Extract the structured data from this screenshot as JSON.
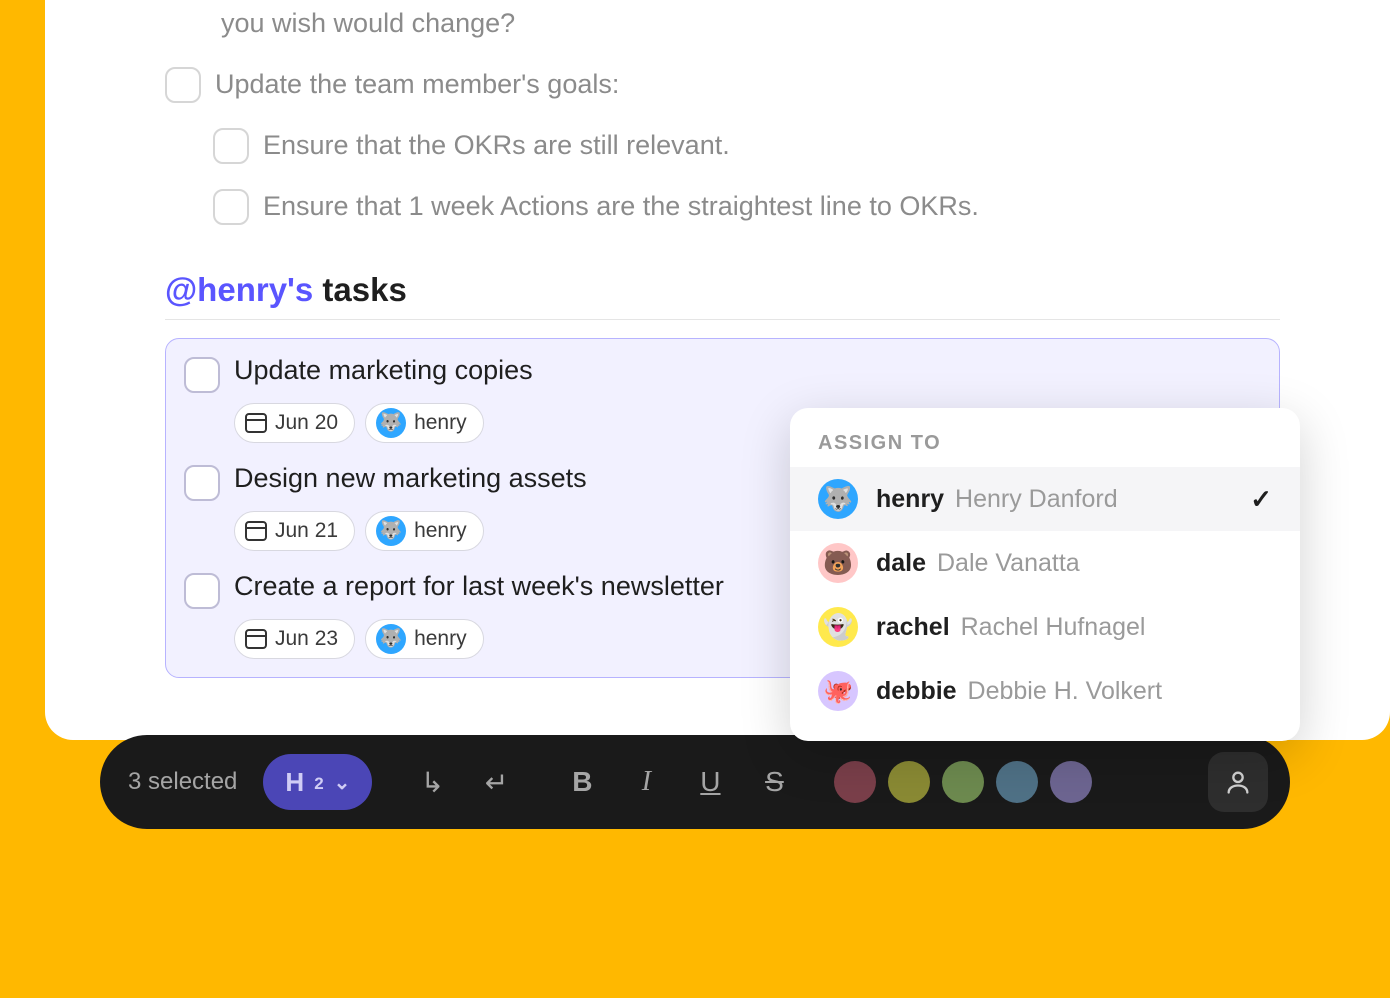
{
  "doc": {
    "lines": [
      {
        "kind": "text",
        "text": "you wish would change?"
      },
      {
        "kind": "check",
        "text": "Update the team member's goals:"
      },
      {
        "kind": "check_indent",
        "text": "Ensure that the OKRs are still relevant."
      },
      {
        "kind": "check_indent",
        "text": "Ensure that 1 week Actions are the straightest line to OKRs."
      }
    ]
  },
  "section": {
    "mention": "@henry's",
    "title_rest": " tasks"
  },
  "tasks": [
    {
      "title": "Update marketing copies",
      "date": "Jun 20",
      "assignee_name": "henry",
      "assignee_av": "av-blue",
      "assignee_emoji": "🐺"
    },
    {
      "title": "Design new marketing assets",
      "date": "Jun 21",
      "assignee_name": "henry",
      "assignee_av": "av-blue",
      "assignee_emoji": "🐺"
    },
    {
      "title": "Create a report for last week's newsletter",
      "date": "Jun 23",
      "assignee_name": "henry",
      "assignee_av": "av-blue",
      "assignee_emoji": "🐺"
    }
  ],
  "popup": {
    "header": "ASSIGN TO",
    "items": [
      {
        "username": "henry",
        "fullname": "Henry Danford",
        "av": "av-blue",
        "emoji": "🐺",
        "selected": true
      },
      {
        "username": "dale",
        "fullname": "Dale Vanatta",
        "av": "av-pink",
        "emoji": "🐻",
        "selected": false
      },
      {
        "username": "rachel",
        "fullname": "Rachel Hufnagel",
        "av": "av-yellow",
        "emoji": "👻",
        "selected": false
      },
      {
        "username": "debbie",
        "fullname": "Debbie H. Volkert",
        "av": "av-lilac",
        "emoji": "🐙",
        "selected": false
      }
    ]
  },
  "toolbar": {
    "selection": "3 selected",
    "heading_label_main": "H",
    "heading_label_sub": "2",
    "buttons": {
      "indent": "↳",
      "outdent": "↵",
      "bold": "B",
      "italic": "I",
      "underline": "U",
      "strike": "S"
    },
    "colors": [
      "#7a3f4a",
      "#8a8a34",
      "#6d8a4f",
      "#4f7186",
      "#6d6591"
    ]
  }
}
